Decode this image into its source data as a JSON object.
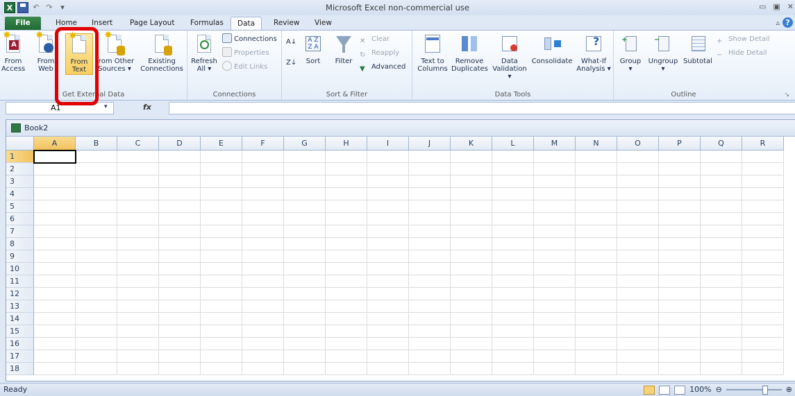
{
  "window": {
    "title": "Microsoft Excel non-commercial use"
  },
  "tabs": [
    {
      "label": "File"
    },
    {
      "label": "Home"
    },
    {
      "label": "Insert"
    },
    {
      "label": "Page Layout"
    },
    {
      "label": "Formulas"
    },
    {
      "label": "Data"
    },
    {
      "label": "Review"
    },
    {
      "label": "View"
    }
  ],
  "ribbon": {
    "get_external": {
      "label": "Get External Data",
      "from_access": [
        "From",
        "Access"
      ],
      "from_web": [
        "From",
        "Web"
      ],
      "from_text": [
        "From",
        "Text"
      ],
      "from_other": [
        "From Other",
        "Sources ▾"
      ],
      "existing": [
        "Existing",
        "Connections"
      ]
    },
    "connections": {
      "label": "Connections",
      "refresh": [
        "Refresh",
        "All ▾"
      ],
      "connections": "Connections",
      "properties": "Properties",
      "edit_links": "Edit Links"
    },
    "sort_filter": {
      "label": "Sort & Filter",
      "sort": "Sort",
      "filter": "Filter",
      "clear": "Clear",
      "reapply": "Reapply",
      "advanced": "Advanced"
    },
    "data_tools": {
      "label": "Data Tools",
      "text_to_columns": [
        "Text to",
        "Columns"
      ],
      "remove_dup": [
        "Remove",
        "Duplicates"
      ],
      "validation": [
        "Data",
        "Validation ▾"
      ],
      "consolidate": "Consolidate",
      "whatif": [
        "What-If",
        "Analysis ▾"
      ]
    },
    "outline": {
      "label": "Outline",
      "group": "Group",
      "ungroup": "Ungroup",
      "subtotal": "Subtotal",
      "show_detail": "Show Detail",
      "hide_detail": "Hide Detail"
    }
  },
  "formula": {
    "namebox": "A1",
    "fx": "fx",
    "value": ""
  },
  "workbook": {
    "title": "Book2"
  },
  "columns": [
    "A",
    "B",
    "C",
    "D",
    "E",
    "F",
    "G",
    "H",
    "I",
    "J",
    "K",
    "L",
    "M",
    "N",
    "O",
    "P",
    "Q",
    "R"
  ],
  "rows": [
    "1",
    "2",
    "3",
    "4",
    "5",
    "6",
    "7",
    "8",
    "9",
    "10",
    "11",
    "12",
    "13",
    "14",
    "15",
    "16",
    "17",
    "18"
  ],
  "status": {
    "text": "Ready",
    "zoom": "100%"
  }
}
